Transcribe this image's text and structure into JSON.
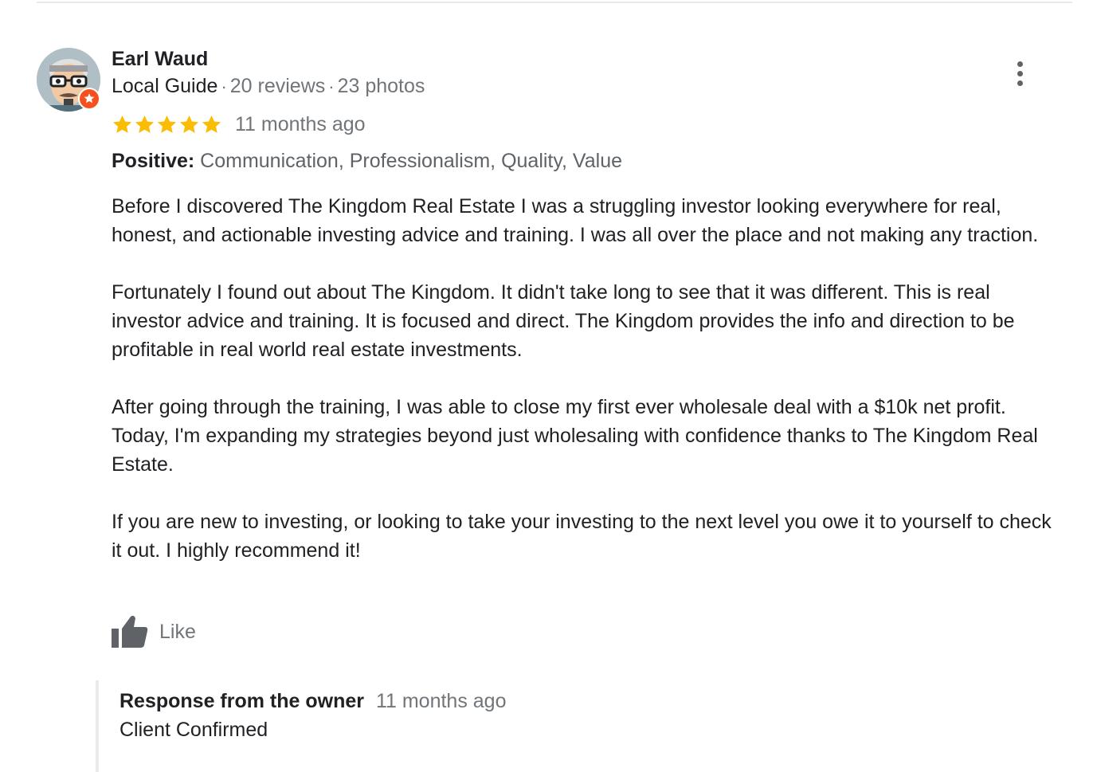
{
  "review": {
    "author": {
      "name": "Earl Waud",
      "badge": "Local Guide",
      "separator": "·",
      "reviews_count": "20 reviews",
      "photos_count": "23 photos"
    },
    "rating": 5,
    "rating_max": 5,
    "date": "11 months ago",
    "highlights": {
      "label": "Positive:",
      "values": "Communication, Professionalism, Quality, Value"
    },
    "paragraphs": [
      "Before I discovered The Kingdom Real Estate I was a struggling investor looking everywhere for real, honest, and actionable investing advice and training. I  was all over the place and not making any traction.",
      "Fortunately I found out about The Kingdom. It didn't take long to see that it was different.  This is real investor advice and training. It is focused and direct. The Kingdom provides the info and direction to be profitable in real world real estate investments.",
      "After going through the training, I was able to close my first ever wholesale deal with a $10k net profit. Today, I'm expanding my strategies beyond just wholesaling with confidence thanks to The Kingdom Real Estate.",
      "If you are new to investing, or looking to take your investing to the next level you owe it to yourself to check it out.  I  highly recommend it!"
    ],
    "like_label": "Like",
    "icons": {
      "more": "more-vert-icon",
      "like": "thumbs-up-icon",
      "star": "star-icon",
      "guide_badge": "local-guide-badge-icon"
    },
    "colors": {
      "star": "#FBBC04",
      "badge": "#F4511E",
      "muted_text": "#70757a"
    }
  },
  "owner_response": {
    "title": "Response from the owner",
    "date": "11 months ago",
    "text": "Client Confirmed"
  }
}
